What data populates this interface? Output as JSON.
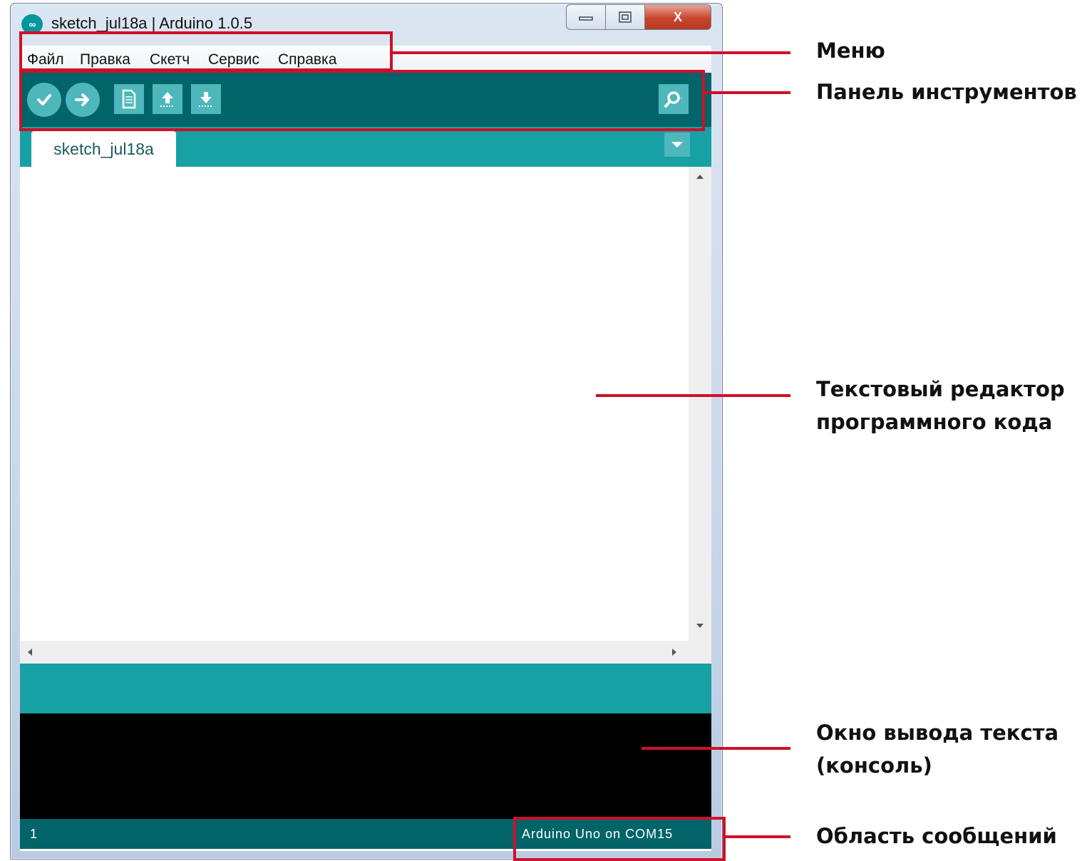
{
  "window": {
    "title": "sketch_jul18a | Arduino 1.0.5",
    "app_icon": "arduino-logo-icon",
    "controls": {
      "minimize": "minimize-icon",
      "maximize": "maximize-icon",
      "close": "X"
    }
  },
  "menu": {
    "items": [
      "Файл",
      "Правка",
      "Скетч",
      "Сервис",
      "Справка"
    ]
  },
  "toolbar": {
    "icons": [
      "verify-icon",
      "upload-icon",
      "new-file-icon",
      "open-icon",
      "save-icon",
      "serial-monitor-icon"
    ]
  },
  "tabs": {
    "active": "sketch_jul18a",
    "menu_icon": "tab-dropdown-icon"
  },
  "status_bar": {
    "line_number": "1",
    "board": "Arduino Uno on COM15"
  },
  "annotations": {
    "menu": "Меню",
    "toolbar": "Панель инструментов",
    "editor_line1": "Текстовый редактор",
    "editor_line2": "программного кода",
    "console_line1": "Окно вывода текста",
    "console_line2": "(консоль)",
    "messages": "Область сообщений"
  },
  "colors": {
    "toolbar_dark_teal": "#006468",
    "tab_teal": "#17a1a5",
    "button_teal": "#4db7bb",
    "console_bg": "#000000",
    "annotation_red": "#d0102a"
  }
}
